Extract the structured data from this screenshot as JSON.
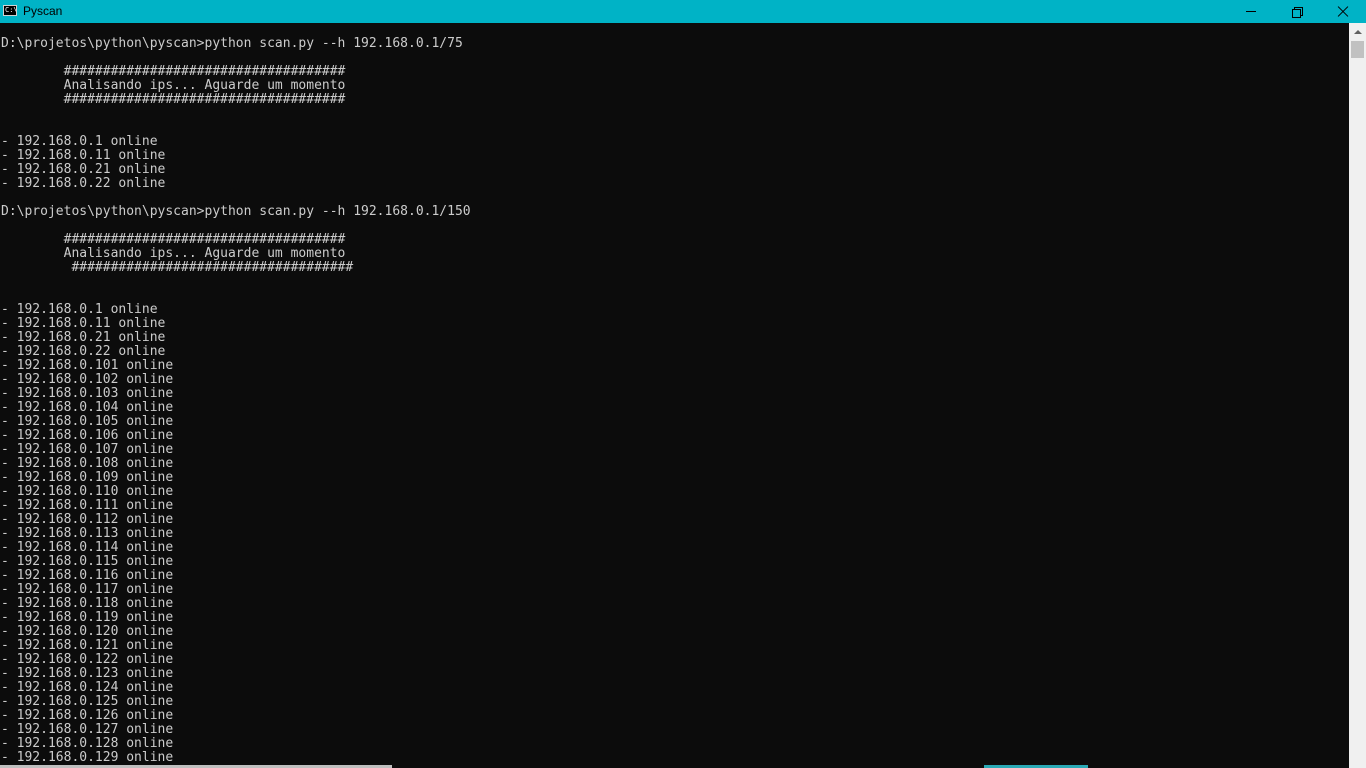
{
  "window": {
    "title": "Pyscan",
    "icon": "console-icon",
    "icon_glyph": "C:\\"
  },
  "console": {
    "lines": [
      "D:\\projetos\\python\\pyscan>python scan.py --h 192.168.0.1/75",
      "",
      "        ####################################",
      "        Analisando ips... Aguarde um momento",
      "        ####################################",
      "",
      "",
      "- 192.168.0.1 online",
      "- 192.168.0.11 online",
      "- 192.168.0.21 online",
      "- 192.168.0.22 online",
      "",
      "D:\\projetos\\python\\pyscan>python scan.py --h 192.168.0.1/150",
      "",
      "        ####################################",
      "        Analisando ips... Aguarde um momento",
      "         ####################################",
      "",
      "",
      "- 192.168.0.1 online",
      "- 192.168.0.11 online",
      "- 192.168.0.21 online",
      "- 192.168.0.22 online",
      "- 192.168.0.101 online",
      "- 192.168.0.102 online",
      "- 192.168.0.103 online",
      "- 192.168.0.104 online",
      "- 192.168.0.105 online",
      "- 192.168.0.106 online",
      "- 192.168.0.107 online",
      "- 192.168.0.108 online",
      "- 192.168.0.109 online",
      "- 192.168.0.110 online",
      "- 192.168.0.111 online",
      "- 192.168.0.112 online",
      "- 192.168.0.113 online",
      "- 192.168.0.114 online",
      "- 192.168.0.115 online",
      "- 192.168.0.116 online",
      "- 192.168.0.117 online",
      "- 192.168.0.118 online",
      "- 192.168.0.119 online",
      "- 192.168.0.120 online",
      "- 192.168.0.121 online",
      "- 192.168.0.122 online",
      "- 192.168.0.123 online",
      "- 192.168.0.124 online",
      "- 192.168.0.125 online",
      "- 192.168.0.126 online",
      "- 192.168.0.127 online",
      "- 192.168.0.128 online",
      "- 192.168.0.129 online"
    ]
  },
  "colors": {
    "titlebar": "#00b3c6",
    "console_background": "#0c0c0c",
    "console_text": "#cccccc"
  }
}
